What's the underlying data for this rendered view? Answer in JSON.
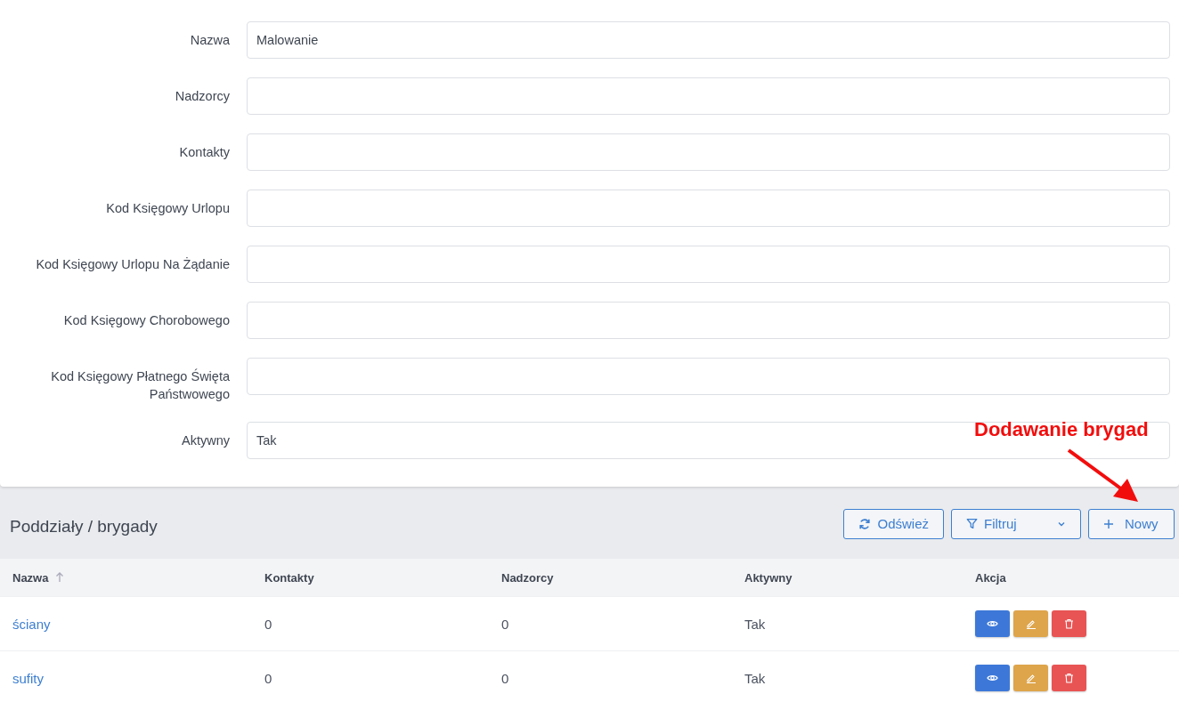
{
  "form": {
    "fields": [
      {
        "label": "Nazwa",
        "value": "Malowanie"
      },
      {
        "label": "Nadzorcy"
      },
      {
        "label": "Kontakty"
      },
      {
        "label": "Kod Księgowy Urlopu"
      },
      {
        "label": "Kod Księgowy Urlopu Na Żądanie"
      },
      {
        "label": "Kod Księgowy Chorobowego"
      },
      {
        "label": "Kod Księgowy Płatnego Święta Państwowego"
      },
      {
        "label": "Aktywny",
        "value": "Tak"
      }
    ]
  },
  "annotation": {
    "text": "Dodawanie brygad"
  },
  "section": {
    "title": "Poddziały / brygady",
    "buttons": [
      {
        "kind": "refresh",
        "label": "Odśwież"
      },
      {
        "kind": "filter",
        "label": "Filtruj"
      },
      {
        "kind": "new",
        "label": "Nowy"
      }
    ]
  },
  "table": {
    "columns": [
      {
        "label": "Nazwa",
        "sorted": true
      },
      {
        "label": "Kontakty",
        "sorted": false
      },
      {
        "label": "Nadzorcy",
        "sorted": false
      },
      {
        "label": "Aktywny",
        "sorted": false
      },
      {
        "label": "Akcja",
        "sorted": false
      }
    ],
    "rows": [
      {
        "name": "ściany",
        "contacts": "0",
        "supervisors": "0",
        "active": "Tak"
      },
      {
        "name": "sufity",
        "contacts": "0",
        "supervisors": "0",
        "active": "Tak"
      }
    ]
  }
}
